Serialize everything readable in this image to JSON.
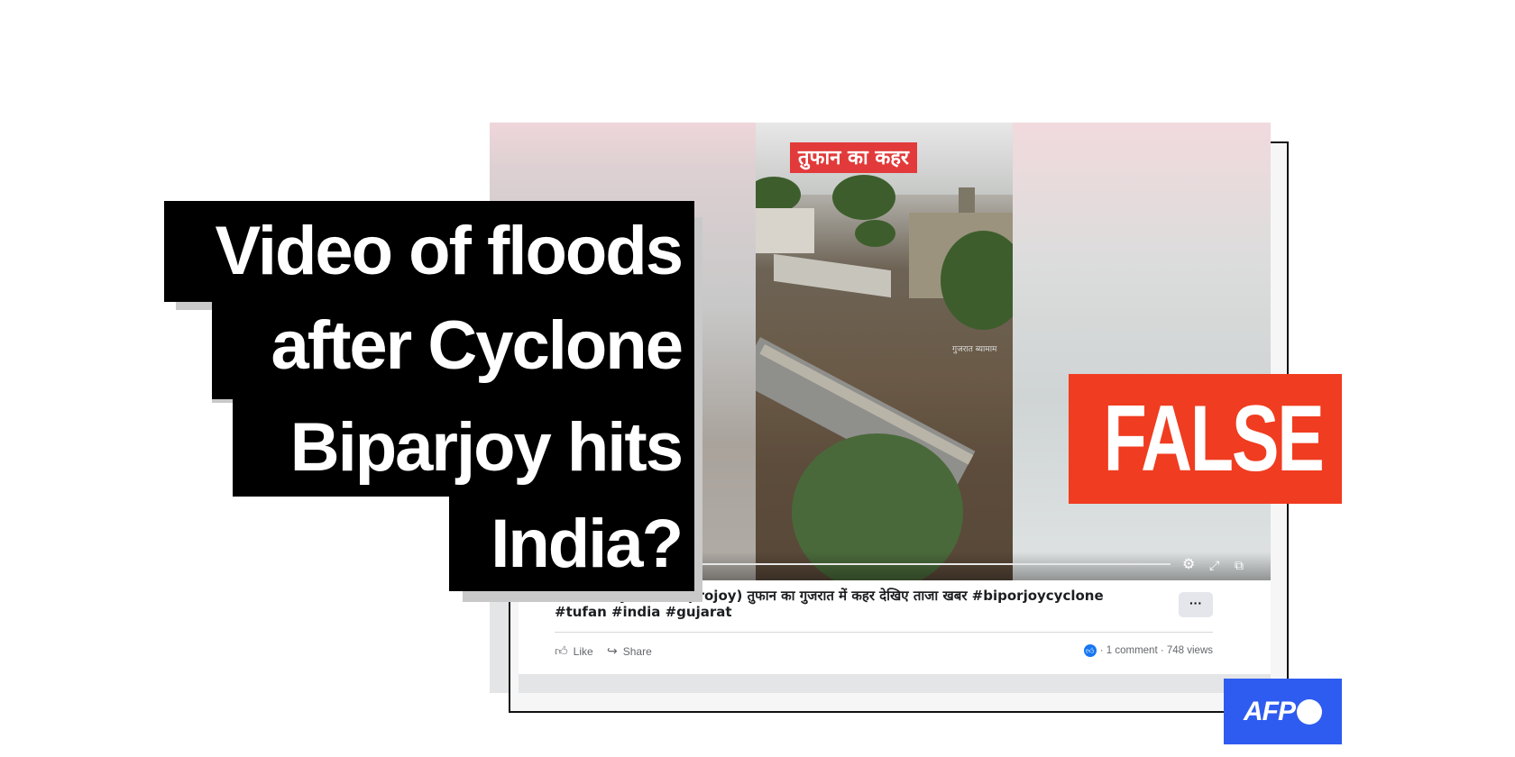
{
  "headline": {
    "lines": [
      "Video of floods",
      "after Cyclone",
      "Biparjoy hits",
      "India?"
    ]
  },
  "verdict": "FALSE",
  "logo": "AFP",
  "video": {
    "overlay_text": "तुफान का कहर",
    "watermark": "गुजरात ब्यामाम",
    "control_icons": [
      "settings-icon",
      "fullscreen-icon",
      "picture-in-picture-icon"
    ]
  },
  "post": {
    "caption": "बीपरजॉय (cyclone biprojoy) तुफान का गुजरात में कहर देखिए ताजा खबर #biporjoycyclone #tufan #india #gujarat",
    "more_label": "···",
    "like_label": "Like",
    "share_label": "Share",
    "stats": "· 1 comment · 748 views"
  },
  "colors": {
    "verdict_red": "#f03c20",
    "afp_blue": "#2f5cf0",
    "banner_red": "#e23a3a",
    "facebook_blue": "#1877f2"
  }
}
